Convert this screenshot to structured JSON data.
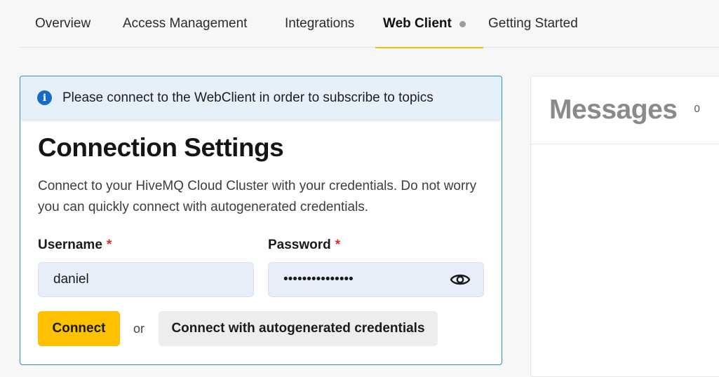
{
  "tabs": [
    {
      "label": "Overview",
      "active": false
    },
    {
      "label": "Access Management",
      "active": false
    },
    {
      "label": "Integrations",
      "active": false
    },
    {
      "label": "Web Client",
      "active": true
    },
    {
      "label": "Getting Started",
      "active": false
    }
  ],
  "banner": {
    "icon": "info-icon",
    "text": "Please connect to the WebClient in order to subscribe to topics"
  },
  "connection": {
    "title": "Connection Settings",
    "description": "Connect to your HiveMQ Cloud Cluster with your credentials. Do not worry you can quickly connect with autogenerated credentials.",
    "username_label": "Username",
    "username_value": "daniel",
    "password_label": "Password",
    "password_value": "•••••••••••••••",
    "required_marker": "*",
    "connect_label": "Connect",
    "or_text": "or",
    "autogen_label": "Connect with autogenerated credentials"
  },
  "messages": {
    "title": "Messages",
    "count": "0"
  },
  "colors": {
    "accent": "#fdc100",
    "info": "#1769c4",
    "card_border": "#2e8fd0",
    "required": "#d93025"
  }
}
